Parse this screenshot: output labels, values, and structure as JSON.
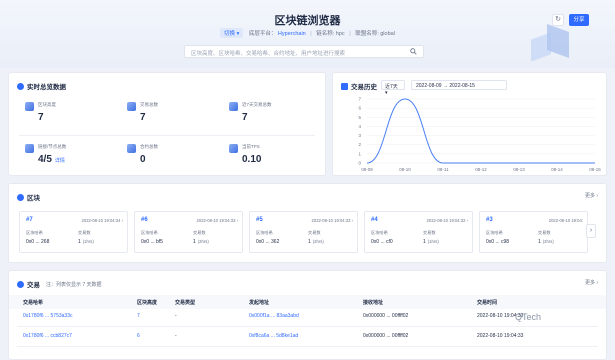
{
  "header": {
    "title": "区块链浏览器",
    "switch_label": "切换 ▾",
    "chain_info": "底层平台：",
    "platform": "Hyperchain",
    "chain_name_label": "链名称: hpc",
    "consortium_label": "联盟名称: global",
    "search_placeholder": "区块高度、区块哈希、交易哈希、合约地址、用户地址进行搜索",
    "share_label": "分享",
    "refresh_icon": "↻"
  },
  "overview": {
    "title": "实时总览数据",
    "items": [
      {
        "label": "区块高度",
        "value": "7"
      },
      {
        "label": "交易总数",
        "value": "7"
      },
      {
        "label": "近7天交易总数",
        "value": "7"
      },
      {
        "label": "链接/节点总数",
        "value": "4/5",
        "link": "详情"
      },
      {
        "label": "合约总数",
        "value": "0"
      },
      {
        "label": "当前TPS",
        "value": "0.10"
      }
    ]
  },
  "tx_history": {
    "title": "交易历史",
    "range": "近7天 ▾",
    "date_range": "2022-08-09  →  2022-08-15"
  },
  "chart_data": {
    "type": "line",
    "categories": [
      "08-09",
      "08-10",
      "08-11",
      "08-12",
      "08-13",
      "08-14",
      "08-15"
    ],
    "values": [
      0,
      7,
      0,
      0,
      0,
      0,
      0
    ],
    "ylim": [
      0,
      7
    ],
    "yticks": [
      "0",
      "1",
      "2",
      "3",
      "4",
      "5",
      "6",
      "7"
    ],
    "color": "#4a7ff2",
    "grid": true
  },
  "blocks": {
    "title": "区块",
    "more": "更多 ›",
    "items": [
      {
        "num": "#7",
        "time": "2022-08-10 19:04:34 ›",
        "hash": "0x0 ... 268",
        "tx": "1",
        "time2": "(1hrs)"
      },
      {
        "num": "#6",
        "time": "2022-08-10 19:04:33 ›",
        "hash": "0x0 ... bf5",
        "tx": "1",
        "time2": "(2hrs)"
      },
      {
        "num": "#5",
        "time": "2022-08-10 19:04:33 ›",
        "hash": "0x0 ... 362",
        "tx": "1",
        "time2": "(2hrs)"
      },
      {
        "num": "#4",
        "time": "2022-08-10 19:04:32 ›",
        "hash": "0x0 ... cf0",
        "tx": "1",
        "time2": "(1hrs)"
      },
      {
        "num": "#3",
        "time": "2022-08-10 19:04:",
        "hash": "0x0 ... c98",
        "tx": "1",
        "time2": "(2hrs)"
      }
    ],
    "hash_label": "区块哈希",
    "tx_label": "交易数",
    "next": "›"
  },
  "transactions": {
    "title": "交易",
    "subtitle": "注：列表仅显示 7 天数据",
    "more": "更多 ›",
    "headers": [
      "交易哈希",
      "区块高度",
      "交易类型",
      "发起地址",
      "接收地址",
      "交易时间"
    ],
    "rows": [
      {
        "hash": "0x1780f6 ... 5753a33c",
        "height": "7",
        "type": "-",
        "from": "0x000f1a ... 83aa3abd",
        "to": "0x000000 ... 00ffff02",
        "time": "2022-08-10 19:04:33"
      },
      {
        "hash": "0x1780f6 ... ccb827c7",
        "height": "6",
        "type": "-",
        "from": "0xf8ca6a ... 5d8ke1ad",
        "to": "0x000000 ... 00ffff02",
        "time": "2022-08-10 19:04:33"
      }
    ]
  },
  "watermark": "QTech"
}
